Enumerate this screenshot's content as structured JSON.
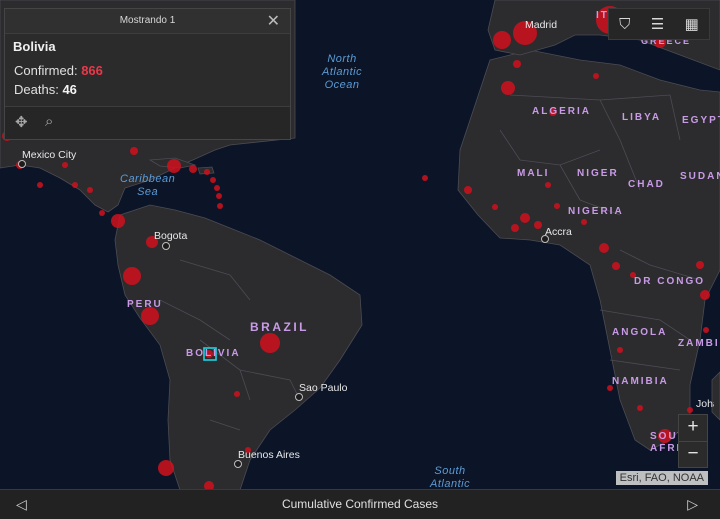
{
  "popup": {
    "header": "Mostrando 1",
    "country": "Bolivia",
    "confirmed_label": "Confirmed:",
    "confirmed_value": "866",
    "deaths_label": "Deaths:",
    "deaths_value": "46",
    "icons": [
      "pan-icon",
      "zoom-to-icon",
      "close-icon"
    ]
  },
  "toolbar": {
    "icons": [
      "bookmark-icon",
      "list-icon",
      "qr-icon"
    ]
  },
  "oceans": [
    {
      "key": "north-atlantic",
      "lines": [
        "North",
        "Atlantic",
        "Ocean"
      ]
    },
    {
      "key": "caribbean",
      "lines": [
        "Caribbean",
        "Sea"
      ]
    },
    {
      "key": "south-atlantic",
      "lines": [
        "South",
        "Atlantic"
      ]
    }
  ],
  "countries": [
    "Madrid",
    "ITALY",
    "GREECE",
    "ALGERIA",
    "LIBYA",
    "EGYPT",
    "MALI",
    "NIGER",
    "CHAD",
    "SUDAN",
    "NIGERIA",
    "DR CONGO",
    "ANGOLA",
    "ZAMBIA",
    "NAMIBIA",
    "BRAZIL",
    "PERU",
    "BOLIVIA",
    "SOUTH AFRICA"
  ],
  "cities": [
    "Mexico City",
    "Bogota",
    "Accra",
    "Sao Paulo",
    "Buenos Aires",
    "Johannesburg"
  ],
  "zoom": {
    "in": "+",
    "out": "−"
  },
  "attribution": "Esri, FAO, NOAA",
  "bottom": {
    "title": "Cumulative Confirmed Cases",
    "prev": "◁",
    "next": "▷"
  },
  "colors": {
    "ocean": "#0b1527",
    "land": "#2c2c2f",
    "border": "#4b4b52",
    "case": "#d0101d",
    "highlight": "#1fd1e0"
  }
}
